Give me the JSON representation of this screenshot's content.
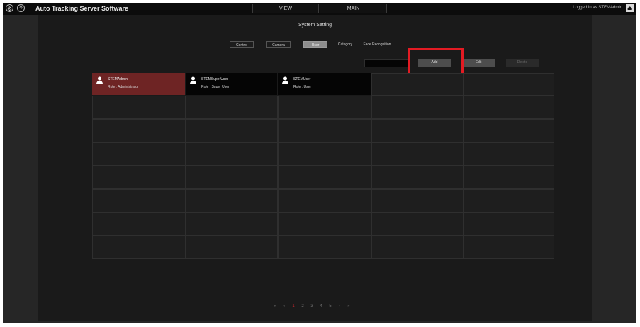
{
  "app": {
    "title": "Auto Tracking Server Software",
    "logged_in": "Logged in as STEMAdmin"
  },
  "icons": {
    "settings": "gear-icon",
    "help": "help-icon",
    "logout": "logout-icon",
    "user": "user-icon"
  },
  "top_tabs": [
    {
      "label": "VIEW"
    },
    {
      "label": "MAIN"
    }
  ],
  "panel": {
    "title": "System Setting"
  },
  "subtabs": [
    {
      "label": "Control",
      "active": false
    },
    {
      "label": "Camera",
      "active": false
    },
    {
      "label": "User",
      "active": true
    },
    {
      "label": "Category",
      "active": false
    },
    {
      "label": "Face Recognition",
      "active": false
    }
  ],
  "actions": {
    "add_label": "Add",
    "edit_label": "Edit",
    "delete_label": "Delete"
  },
  "users": [
    {
      "name": "STEMAdmin",
      "role": "Role : Administrator",
      "selected": true
    },
    {
      "name": "STEMSuperUser",
      "role": "Role : Super User",
      "selected": false
    },
    {
      "name": "STEMUser",
      "role": "Role : User",
      "selected": false
    }
  ],
  "pagination": {
    "items": [
      "«",
      "‹",
      "1",
      "2",
      "3",
      "4",
      "5",
      "›",
      "»"
    ],
    "current": "1"
  },
  "colors": {
    "accent_red": "#e31b23",
    "selected_card": "#6e2424",
    "current_page": "#c9272d"
  }
}
